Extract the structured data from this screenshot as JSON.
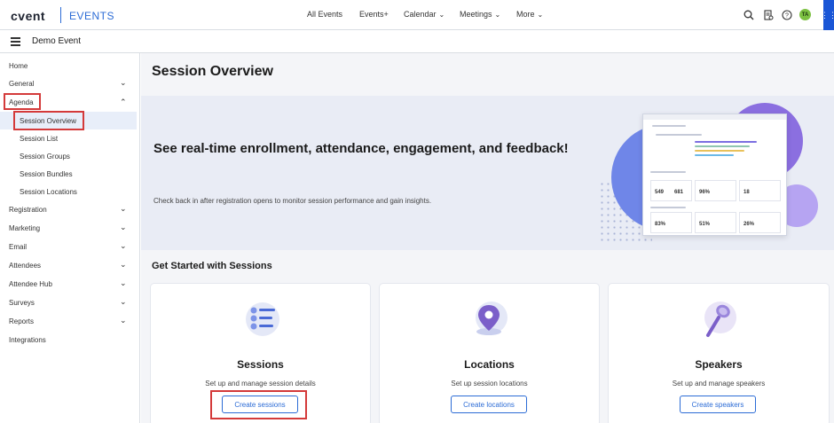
{
  "topbar": {
    "logo": "cvent",
    "product": "EVENTS",
    "nav": [
      {
        "label": "All Events",
        "has_chevron": false
      },
      {
        "label": "Events+",
        "has_chevron": false
      },
      {
        "label": "Calendar",
        "has_chevron": true
      },
      {
        "label": "Meetings",
        "has_chevron": true
      },
      {
        "label": "More",
        "has_chevron": true
      }
    ],
    "icons": [
      "search-icon",
      "document-icon",
      "help-icon",
      "avatar",
      "apps-grid-icon"
    ],
    "avatar_initials": "TA",
    "avatar_color": "#7cc142",
    "accent_color": "#2c6cd6"
  },
  "eventbar": {
    "event_name": "Demo Event"
  },
  "sidebar": {
    "items": [
      {
        "label": "Home",
        "chevron": "none"
      },
      {
        "label": "General",
        "chevron": "down"
      },
      {
        "label": "Agenda",
        "chevron": "up"
      },
      {
        "label": "Session Overview",
        "sub": true,
        "active": true
      },
      {
        "label": "Session List",
        "sub": true
      },
      {
        "label": "Session Groups",
        "sub": true
      },
      {
        "label": "Session Bundles",
        "sub": true
      },
      {
        "label": "Session Locations",
        "sub": true
      },
      {
        "label": "Registration",
        "chevron": "down"
      },
      {
        "label": "Marketing",
        "chevron": "down"
      },
      {
        "label": "Email",
        "chevron": "down"
      },
      {
        "label": "Attendees",
        "chevron": "down"
      },
      {
        "label": "Attendee Hub",
        "chevron": "down"
      },
      {
        "label": "Surveys",
        "chevron": "down"
      },
      {
        "label": "Reports",
        "chevron": "down"
      },
      {
        "label": "Integrations",
        "chevron": "none"
      }
    ]
  },
  "main": {
    "page_title": "Session Overview",
    "hero": {
      "heading": "See real-time enrollment, attendance, engagement, and feedback!",
      "subtext": "Check back in after registration opens to monitor session performance and gain insights.",
      "mock_stats": [
        "549",
        "681",
        "96%",
        "18",
        "83%",
        "51%",
        "26%"
      ]
    },
    "section_title": "Get Started with Sessions",
    "cards": [
      {
        "title": "Sessions",
        "desc": "Set up and manage session details",
        "button": "Create sessions",
        "icon": "sessions-list-icon"
      },
      {
        "title": "Locations",
        "desc": "Set up session locations",
        "button": "Create locations",
        "icon": "location-pin-icon"
      },
      {
        "title": "Speakers",
        "desc": "Set up and manage speakers",
        "button": "Create speakers",
        "icon": "microphone-icon"
      }
    ]
  }
}
